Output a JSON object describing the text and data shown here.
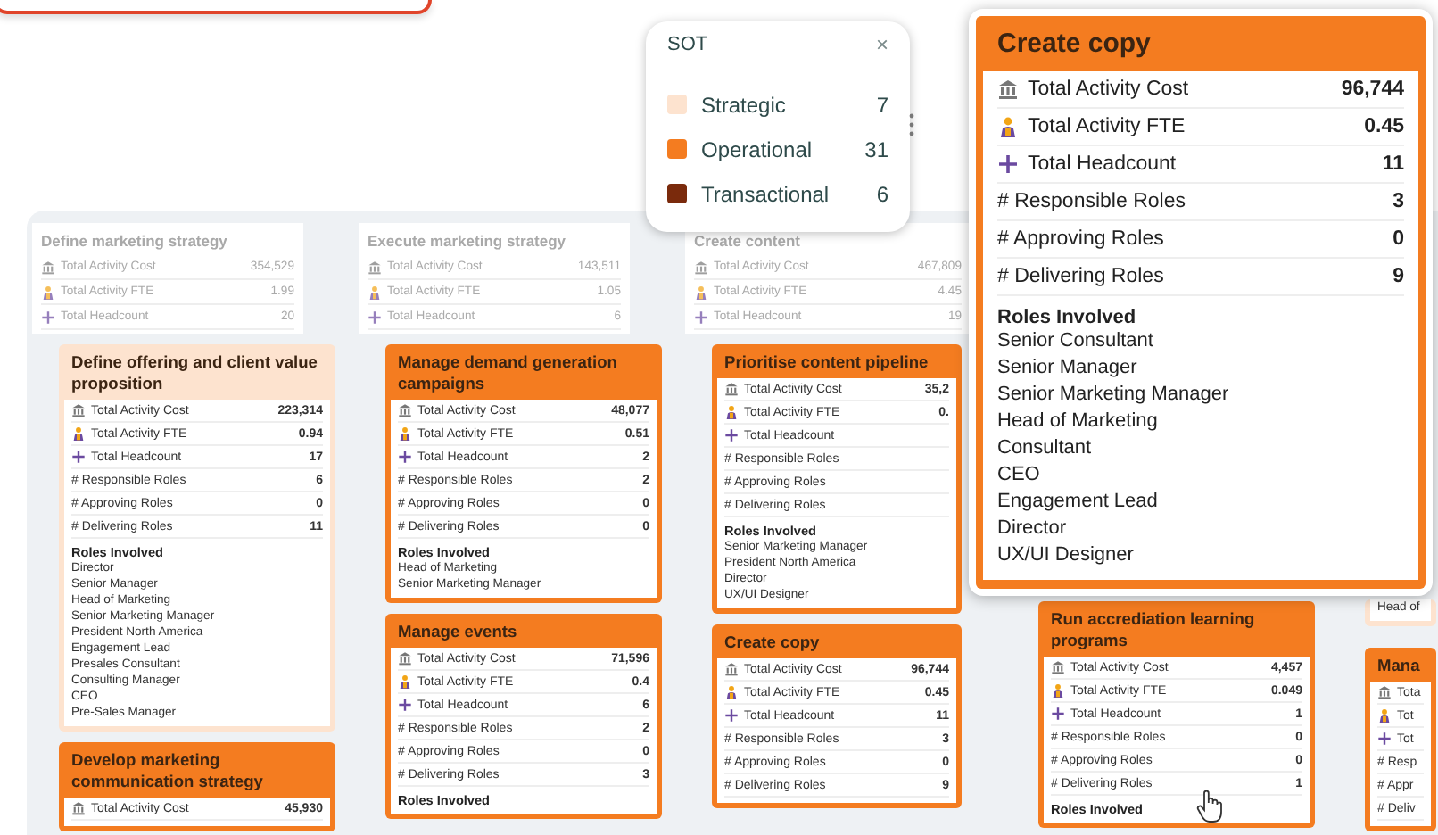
{
  "legend": {
    "title": "SOT",
    "close": "×",
    "items": [
      {
        "label": "Strategic",
        "count": "7",
        "color": "#fde3cf"
      },
      {
        "label": "Operational",
        "count": "31",
        "color": "#f47c20"
      },
      {
        "label": "Transactional",
        "count": "6",
        "color": "#7a2a0c"
      }
    ]
  },
  "columns": [
    {
      "header": {
        "title": "Define marketing strategy",
        "metrics": [
          {
            "kind": "cost",
            "label": "Total Activity Cost",
            "value": "354,529"
          },
          {
            "kind": "fte",
            "label": "Total Activity FTE",
            "value": "1.99"
          },
          {
            "kind": "headcount",
            "label": "Total Headcount",
            "value": "20"
          }
        ]
      },
      "cards": [
        {
          "color": "#fde3cf",
          "title": "Define offering and client value proposition",
          "metrics": [
            {
              "kind": "cost",
              "label": "Total Activity Cost",
              "value": "223,314"
            },
            {
              "kind": "fte",
              "label": "Total Activity FTE",
              "value": "0.94"
            },
            {
              "kind": "headcount",
              "label": "Total Headcount",
              "value": "17"
            },
            {
              "kind": "count",
              "label": "# Responsible Roles",
              "value": "6"
            },
            {
              "kind": "count",
              "label": "# Approving Roles",
              "value": "0"
            },
            {
              "kind": "count",
              "label": "# Delivering Roles",
              "value": "11"
            }
          ],
          "roles_title": "Roles Involved",
          "roles": [
            "Director",
            "Senior Manager",
            "Head of Marketing",
            "Senior Marketing Manager",
            "President North America",
            "Engagement Lead",
            "Presales Consultant",
            "Consulting Manager",
            "CEO",
            "Pre-Sales Manager"
          ]
        },
        {
          "color": "#f47c20",
          "title": "Develop marketing communication strategy",
          "metrics": [
            {
              "kind": "cost",
              "label": "Total Activity Cost",
              "value": "45,930"
            }
          ]
        }
      ]
    },
    {
      "header": {
        "title": "Execute marketing strategy",
        "metrics": [
          {
            "kind": "cost",
            "label": "Total Activity Cost",
            "value": "143,511"
          },
          {
            "kind": "fte",
            "label": "Total Activity FTE",
            "value": "1.05"
          },
          {
            "kind": "headcount",
            "label": "Total Headcount",
            "value": "6"
          }
        ]
      },
      "cards": [
        {
          "color": "#f47c20",
          "title": "Manage demand generation campaigns",
          "metrics": [
            {
              "kind": "cost",
              "label": "Total Activity Cost",
              "value": "48,077"
            },
            {
              "kind": "fte",
              "label": "Total Activity FTE",
              "value": "0.51"
            },
            {
              "kind": "headcount",
              "label": "Total Headcount",
              "value": "2"
            },
            {
              "kind": "count",
              "label": "# Responsible Roles",
              "value": "2"
            },
            {
              "kind": "count",
              "label": "# Approving Roles",
              "value": "0"
            },
            {
              "kind": "count",
              "label": "# Delivering Roles",
              "value": "0"
            }
          ],
          "roles_title": "Roles Involved",
          "roles": [
            "Head of Marketing",
            "Senior Marketing Manager"
          ]
        },
        {
          "color": "#f47c20",
          "title": "Manage events",
          "metrics": [
            {
              "kind": "cost",
              "label": "Total Activity Cost",
              "value": "71,596"
            },
            {
              "kind": "fte",
              "label": "Total Activity FTE",
              "value": "0.4"
            },
            {
              "kind": "headcount",
              "label": "Total Headcount",
              "value": "6"
            },
            {
              "kind": "count",
              "label": "# Responsible Roles",
              "value": "2"
            },
            {
              "kind": "count",
              "label": "# Approving Roles",
              "value": "0"
            },
            {
              "kind": "count",
              "label": "# Delivering Roles",
              "value": "3"
            }
          ],
          "roles_title": "Roles Involved"
        }
      ]
    },
    {
      "header": {
        "title": "Create content",
        "metrics": [
          {
            "kind": "cost",
            "label": "Total Activity Cost",
            "value": "467,809"
          },
          {
            "kind": "fte",
            "label": "Total Activity FTE",
            "value": "4.45"
          },
          {
            "kind": "headcount",
            "label": "Total Headcount",
            "value": "19"
          }
        ]
      },
      "cards": [
        {
          "color": "#f47c20",
          "title": "Prioritise content pipeline",
          "metrics": [
            {
              "kind": "cost",
              "label": "Total Activity Cost",
              "value": "35,2"
            },
            {
              "kind": "fte",
              "label": "Total Activity FTE",
              "value": "0."
            },
            {
              "kind": "headcount",
              "label": "Total Headcount"
            },
            {
              "kind": "count",
              "label": "# Responsible Roles"
            },
            {
              "kind": "count",
              "label": "# Approving Roles"
            },
            {
              "kind": "count",
              "label": "# Delivering Roles"
            }
          ],
          "roles_title": "Roles Involved",
          "roles": [
            "Senior Marketing Manager",
            "President North America",
            "Director",
            "UX/UI Designer"
          ]
        },
        {
          "color": "#f47c20",
          "title": "Create copy",
          "metrics": [
            {
              "kind": "cost",
              "label": "Total Activity Cost",
              "value": "96,744"
            },
            {
              "kind": "fte",
              "label": "Total Activity FTE",
              "value": "0.45"
            },
            {
              "kind": "headcount",
              "label": "Total Headcount",
              "value": "11"
            },
            {
              "kind": "count",
              "label": "# Responsible Roles",
              "value": "3"
            },
            {
              "kind": "count",
              "label": "# Approving Roles",
              "value": "0"
            },
            {
              "kind": "count",
              "label": "# Delivering Roles",
              "value": "9"
            }
          ]
        }
      ]
    },
    {
      "cards": [
        {
          "color": "#f47c20",
          "title": "Run accrediation learning programs",
          "metrics": [
            {
              "kind": "cost",
              "label": "Total Activity Cost",
              "value": "4,457"
            },
            {
              "kind": "fte",
              "label": "Total Activity FTE",
              "value": "0.049"
            },
            {
              "kind": "headcount",
              "label": "Total Headcount",
              "value": "1"
            },
            {
              "kind": "count",
              "label": "# Responsible Roles",
              "value": "0"
            },
            {
              "kind": "count",
              "label": "# Approving Roles",
              "value": "0"
            },
            {
              "kind": "count",
              "label": "# Delivering Roles",
              "value": "1"
            }
          ],
          "roles_title": "Roles Involved"
        }
      ]
    },
    {
      "cards": [
        {
          "color": "#fde3cf",
          "roles": [
            "Head of"
          ]
        },
        {
          "color": "#f47c20",
          "title": "Mana",
          "metrics": [
            {
              "kind": "cost",
              "label": "Tota"
            },
            {
              "kind": "fte",
              "label": "Tot"
            },
            {
              "kind": "headcount",
              "label": "Tot"
            },
            {
              "kind": "count",
              "label": "# Resp"
            },
            {
              "kind": "count",
              "label": "# Appr"
            },
            {
              "kind": "count",
              "label": "# Deliv"
            }
          ]
        }
      ]
    }
  ],
  "zoom_card": {
    "color": "#f47c20",
    "title": "Create copy",
    "metrics": [
      {
        "kind": "cost",
        "label": "Total Activity Cost",
        "value": "96,744"
      },
      {
        "kind": "fte",
        "label": "Total Activity FTE",
        "value": "0.45"
      },
      {
        "kind": "headcount",
        "label": "Total Headcount",
        "value": "11"
      },
      {
        "kind": "count",
        "label": "# Responsible Roles",
        "value": "3"
      },
      {
        "kind": "count",
        "label": "# Approving Roles",
        "value": "0"
      },
      {
        "kind": "count",
        "label": "# Delivering Roles",
        "value": "9"
      }
    ],
    "roles_title": "Roles Involved",
    "roles": [
      "Senior Consultant",
      "Senior Manager",
      "Senior Marketing Manager",
      "Head of Marketing",
      "Consultant",
      "CEO",
      "Engagement Lead",
      "Director",
      "UX/UI Designer"
    ]
  }
}
